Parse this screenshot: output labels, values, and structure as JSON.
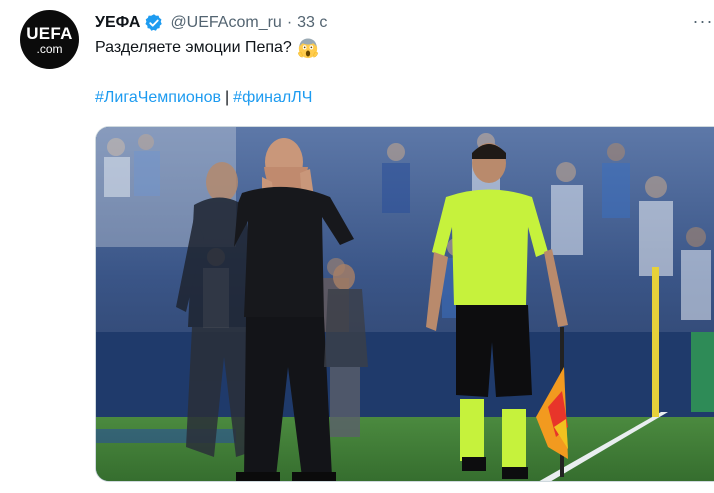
{
  "tweet": {
    "avatar": {
      "line1": "UEFA",
      "line2": ".com"
    },
    "author_name": "УЕФА",
    "handle": "@UEFAcom_ru",
    "separator": "·",
    "time": "33 с",
    "more_icon": "more-icon",
    "text": "Разделяете эмоции Пепа?",
    "emoji": "face-screaming-in-fear",
    "hashtags": [
      "#ЛигаЧемпионов",
      "#финалЛЧ"
    ],
    "hashtag_separator": "|",
    "media": {
      "type": "photo"
    }
  },
  "colors": {
    "accent": "#1d9bf0",
    "text": "#0f1419",
    "muted": "#536471",
    "verified": "#1d9bf0",
    "pitch": "#3f7d3a",
    "referee_shirt": "#c6f23c"
  }
}
